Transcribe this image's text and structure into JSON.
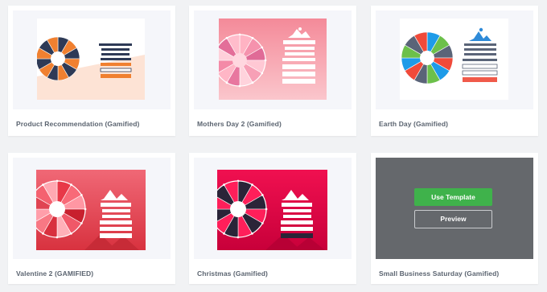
{
  "templates": [
    {
      "title": "Product Recommendation (Gamified)"
    },
    {
      "title": "Mothers Day 2 (Gamified)"
    },
    {
      "title": "Earth Day (Gamified)"
    },
    {
      "title": "Valentine 2 (GAMIFIED)"
    },
    {
      "title": "Christmas (Gamified)"
    },
    {
      "title": "Small Business Saturday (Gamified)"
    }
  ],
  "hover_actions": {
    "use_template_label": "Use Template",
    "preview_label": "Preview"
  },
  "colors": {
    "use_template_button": "#3fb24b",
    "hover_overlay": "#65686c"
  }
}
